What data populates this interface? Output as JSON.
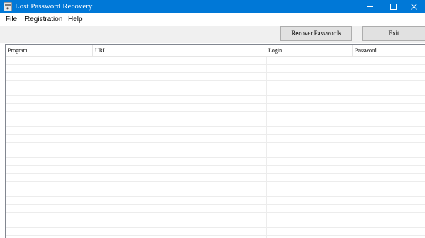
{
  "window": {
    "title": "Lost Password Recovery",
    "icon": "key-app-icon"
  },
  "window_controls": {
    "minimize": "minimize-icon",
    "maximize": "maximize-icon",
    "close": "close-icon"
  },
  "menu": {
    "items": [
      "File",
      "Registration",
      "Help"
    ]
  },
  "toolbar": {
    "recover_label": "Recover Passwords",
    "exit_label": "Exit"
  },
  "table": {
    "columns": [
      "Program",
      "URL",
      "Login",
      "Password"
    ],
    "rows": []
  },
  "colors": {
    "titlebar": "#0078d7",
    "toolbar": "#f0f0f0",
    "button_face": "#e1e1e1",
    "grid_lines": "#ececec"
  }
}
